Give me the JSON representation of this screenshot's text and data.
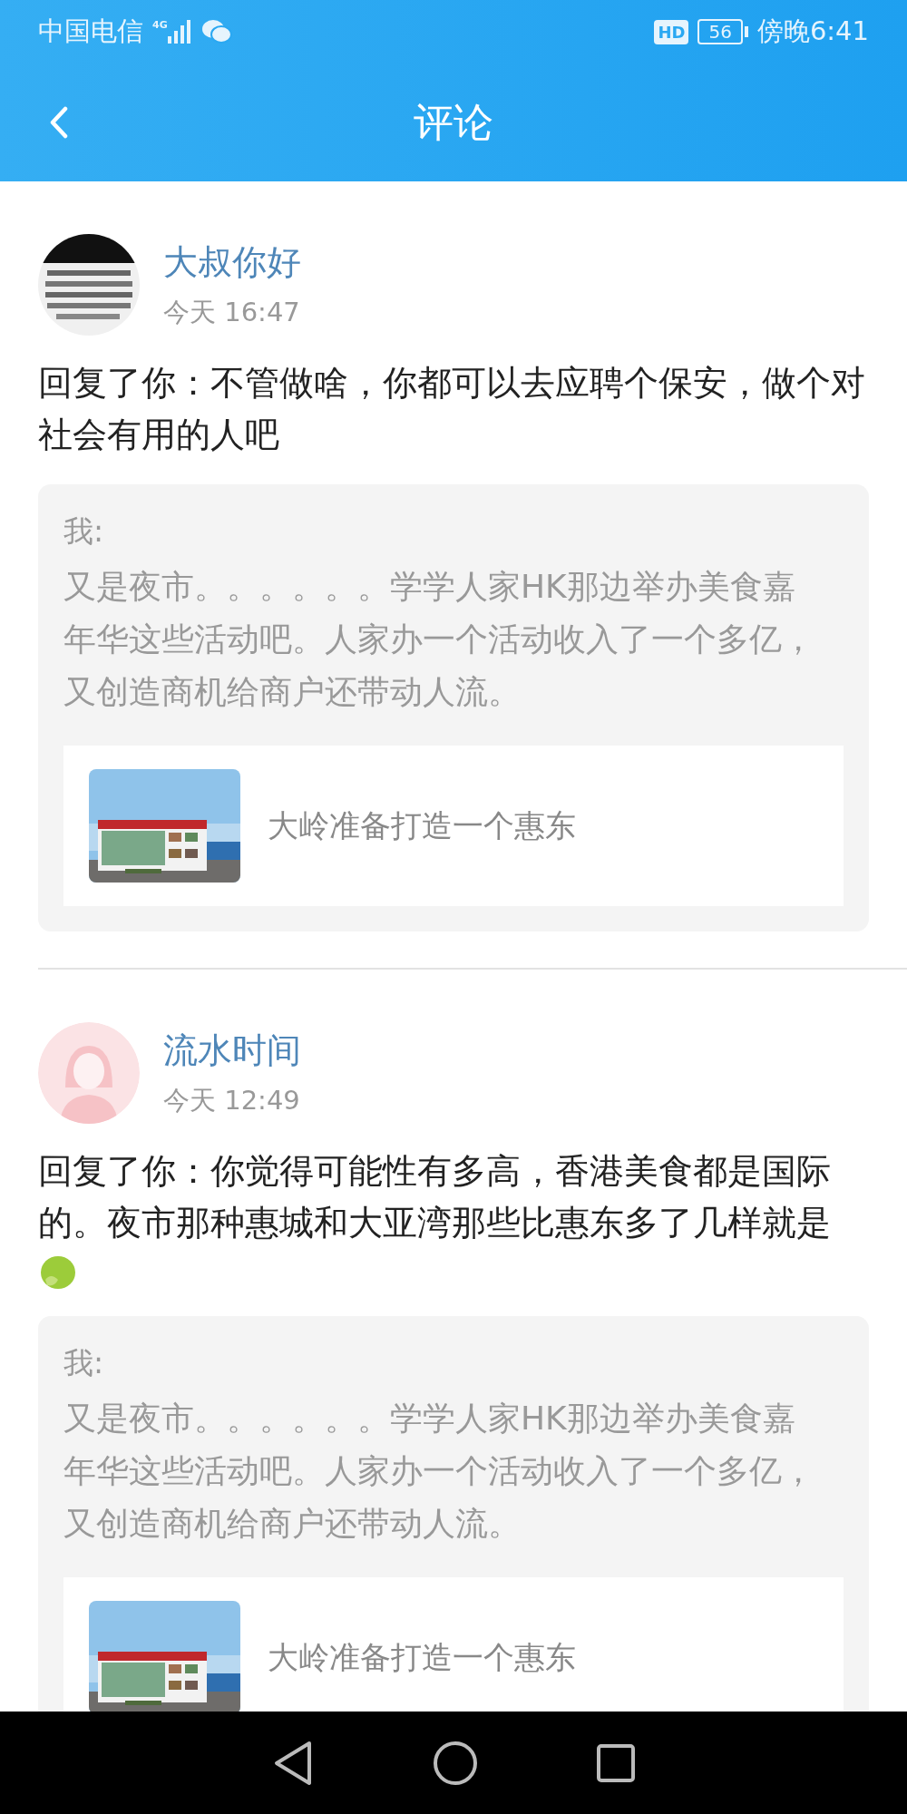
{
  "status_bar": {
    "carrier": "中国电信",
    "network": "4G",
    "hd": "HD",
    "battery": "56",
    "time": "傍晚6:41"
  },
  "header": {
    "title": "评论"
  },
  "comments": [
    {
      "name": "大叔你好",
      "time": "今天 16:47",
      "kind": "picture",
      "text": "回复了你：不管做啥，你都可以去应聘个保安，做个对社会有用的人吧",
      "emoji": false,
      "quote": {
        "author": "我:",
        "text": "又是夜市。。。。。。学学人家HK那边举办美食嘉年华这些活动吧。人家办一个活动收入了一个多亿，又创造商机给商户还带动人流。",
        "link": "大岭准备打造一个惠东"
      }
    },
    {
      "name": "流水时间",
      "time": "今天 12:49",
      "kind": "silhouette",
      "text": "回复了你：你觉得可能性有多高，香港美食都是国际的。夜市那种惠城和大亚湾那些比惠东多了几样就是",
      "emoji": true,
      "quote": {
        "author": "我:",
        "text": "又是夜市。。。。。。学学人家HK那边举办美食嘉年华这些活动吧。人家办一个活动收入了一个多亿，又创造商机给商户还带动人流。",
        "link": "大岭准备打造一个惠东"
      }
    }
  ]
}
